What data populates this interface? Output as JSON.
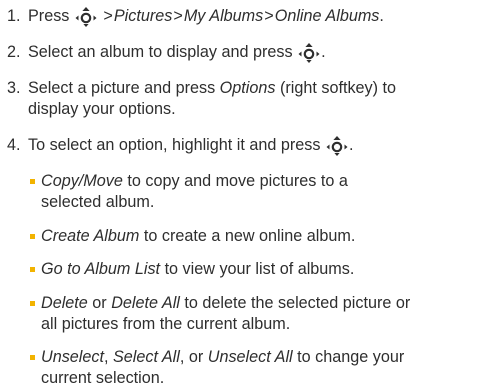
{
  "accent_color": "#f2b300",
  "nav_key_icon": "navigation-key-icon",
  "steps": [
    {
      "num": "1.",
      "pre": "Press",
      "path": [
        "Pictures",
        "My Albums",
        "Online Albums"
      ],
      "separator": ">",
      "end": "."
    },
    {
      "num": "2.",
      "text": "Select an album to display and press",
      "end": "."
    },
    {
      "num": "3.",
      "pre": "Select a picture and press",
      "emph": "Options",
      "post": "(right softkey) to",
      "line2": "display your options."
    },
    {
      "num": "4.",
      "text": "To select an option, highlight it and press",
      "end": "."
    }
  ],
  "options": [
    {
      "emph1": "Copy/Move",
      "text1": "to copy and move pictures to a",
      "line2": "selected album."
    },
    {
      "emph1": "Create Album",
      "text1": "to create a new online album."
    },
    {
      "emph1": "Go to Album List",
      "text1": "to view your list of albums."
    },
    {
      "emph1": "Delete",
      "mid1": "or",
      "emph2": "Delete All",
      "text1": "to delete the selected picture or",
      "line2": "all pictures from the current album."
    },
    {
      "emph1": "Unselect",
      "mid1": ",",
      "emph2": "Select All",
      "mid2": ", or",
      "emph3": "Unselect All",
      "text1": "to change your",
      "line2": "current selection."
    }
  ]
}
